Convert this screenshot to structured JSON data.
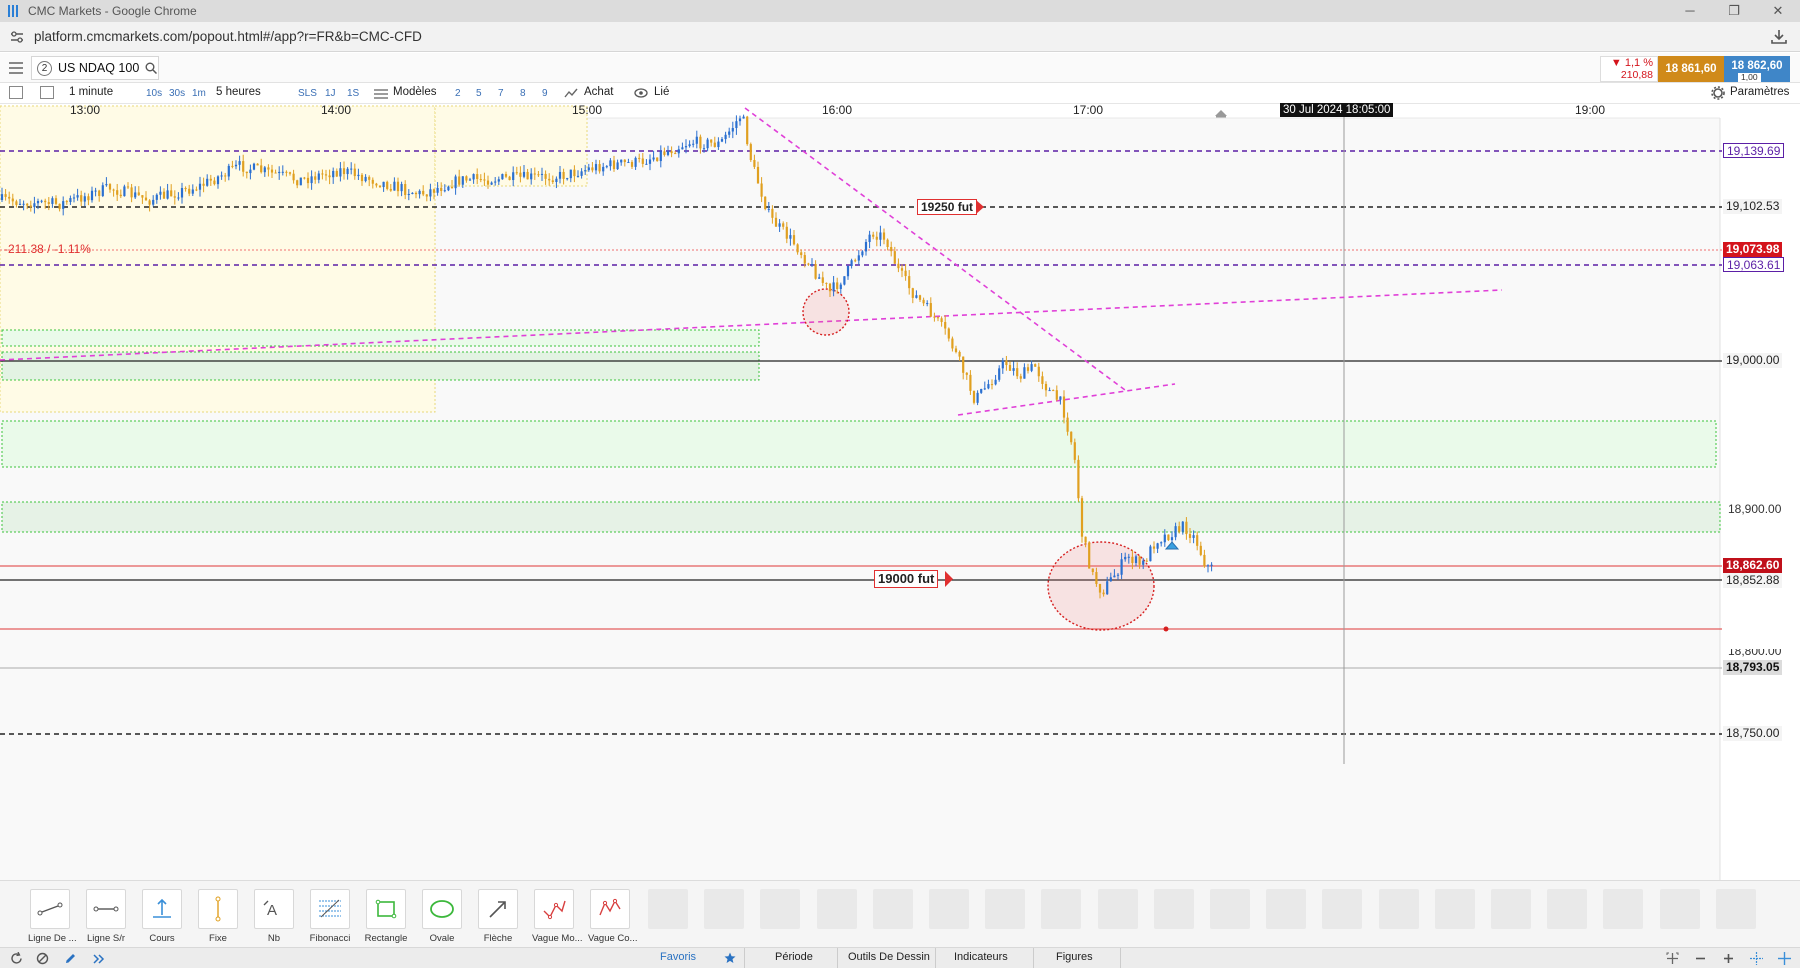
{
  "window": {
    "title": "CMC Markets - Google Chrome",
    "url": "platform.cmcmarkets.com/popout.html#/app?r=FR&b=CMC-CFD"
  },
  "instrument": {
    "tab_count": "2",
    "symbol": "US NDAQ 100",
    "change_pct": "▼ 1,1 %",
    "change_pts": "210,88",
    "sell_price": "18 861,60",
    "buy_price": "18 862,60",
    "spread": "1,00"
  },
  "toolbar": {
    "interval": "1 minute",
    "quick_intervals": [
      "10s",
      "30s",
      "1m"
    ],
    "range": "5 heures",
    "quick_ranges": [
      "SLS",
      "1J",
      "1S"
    ],
    "templates": "Modèles",
    "layouts": [
      "2",
      "5",
      "7",
      "8",
      "9"
    ],
    "buy": "Achat",
    "linked": "Lié",
    "settings": "Paramètres"
  },
  "chart": {
    "time_labels": [
      "13:00",
      "14:00",
      "15:00",
      "16:00",
      "17:00",
      "19:00"
    ],
    "crosshair_time": "30 Jul 2024 18:05:00",
    "change_annotation": "-211.38 / -1.11%",
    "alert_labels": [
      "19250 fut",
      "19000 fut"
    ],
    "price_labels": {
      "p19139": "19,139.69",
      "p19102": "19,102.53",
      "p19073": "19,073.98",
      "p19063": "19,063.61",
      "p19000": "19,000.00",
      "p18900": "18,900.00",
      "p18862": "18,862.60",
      "p18852": "18,852.88",
      "p18800": "18,800.00",
      "p18793": "18,793.05",
      "p18750": "18,750.00"
    },
    "colors": {
      "purple_level": "#5b1fa6",
      "red_level": "#d4141c",
      "trendline": "#e040d8",
      "zone_fill": "#e6f7e6",
      "zone_border": "#3cc43c",
      "candle": "#e0a020",
      "candle_alt": "#2a6fd0"
    }
  },
  "draw_tools": [
    {
      "label": "Ligne De ..."
    },
    {
      "label": "Ligne S/r"
    },
    {
      "label": "Cours"
    },
    {
      "label": "Fixe"
    },
    {
      "label": "Nb"
    },
    {
      "label": "Fibonacci"
    },
    {
      "label": "Rectangle"
    },
    {
      "label": "Ovale"
    },
    {
      "label": "Flèche"
    },
    {
      "label": "Vague Mo..."
    },
    {
      "label": "Vague Co..."
    }
  ],
  "bottom_tabs": [
    "Favoris",
    "Période",
    "Outils De Dessin",
    "Indicateurs",
    "Figures"
  ]
}
